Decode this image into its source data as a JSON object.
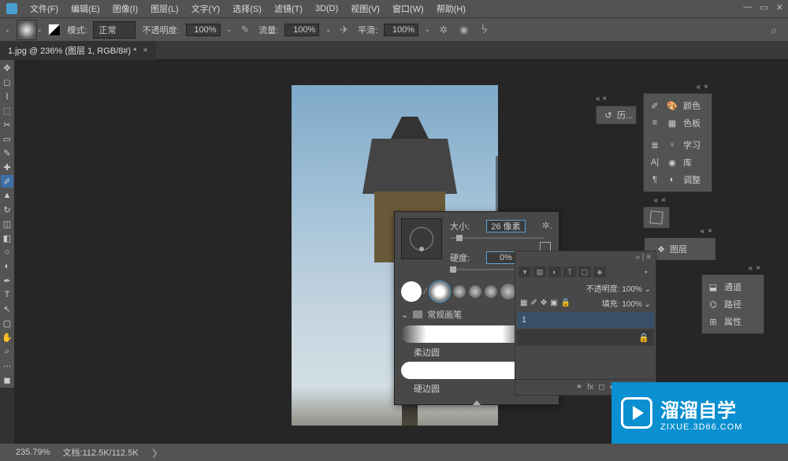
{
  "menubar": {
    "items": [
      "文件(F)",
      "编辑(E)",
      "图像(I)",
      "图层(L)",
      "文字(Y)",
      "选择(S)",
      "滤镜(T)",
      "3D(D)",
      "视图(V)",
      "窗口(W)",
      "帮助(H)"
    ]
  },
  "optionsbar": {
    "mode_label": "模式:",
    "mode_value": "正常",
    "opacity_label": "不透明度:",
    "opacity_value": "100%",
    "flow_label": "流量:",
    "flow_value": "100%",
    "smooth_label": "平滑:",
    "smooth_value": "100%"
  },
  "document": {
    "tab": "1.jpg @ 236% (图层 1, RGB/8#) *"
  },
  "brush_popup": {
    "size_label": "大小:",
    "size_value": "26 像素",
    "hardness_label": "硬度:",
    "hardness_value": "0%",
    "group_name": "常规画笔",
    "preset1": "柔边圆",
    "preset2": "硬边圆"
  },
  "panels": {
    "history": "历...",
    "color": "颜色",
    "swatches": "色板",
    "learn": "学习",
    "libraries": "库",
    "adjustments": "调整",
    "layers": "图层",
    "channels": "通道",
    "paths": "路径",
    "properties": "属性"
  },
  "layers_panel": {
    "opacity_label": "不透明度:",
    "opacity_value": "100%",
    "fill_label": "填充:",
    "fill_value": "100%",
    "layer1": "1"
  },
  "statusbar": {
    "zoom": "235.79%",
    "filesize": "文档:112.5K/112.5K"
  },
  "watermark": {
    "title": "溜溜自学",
    "url": "ZIXUE.3D66.COM"
  }
}
